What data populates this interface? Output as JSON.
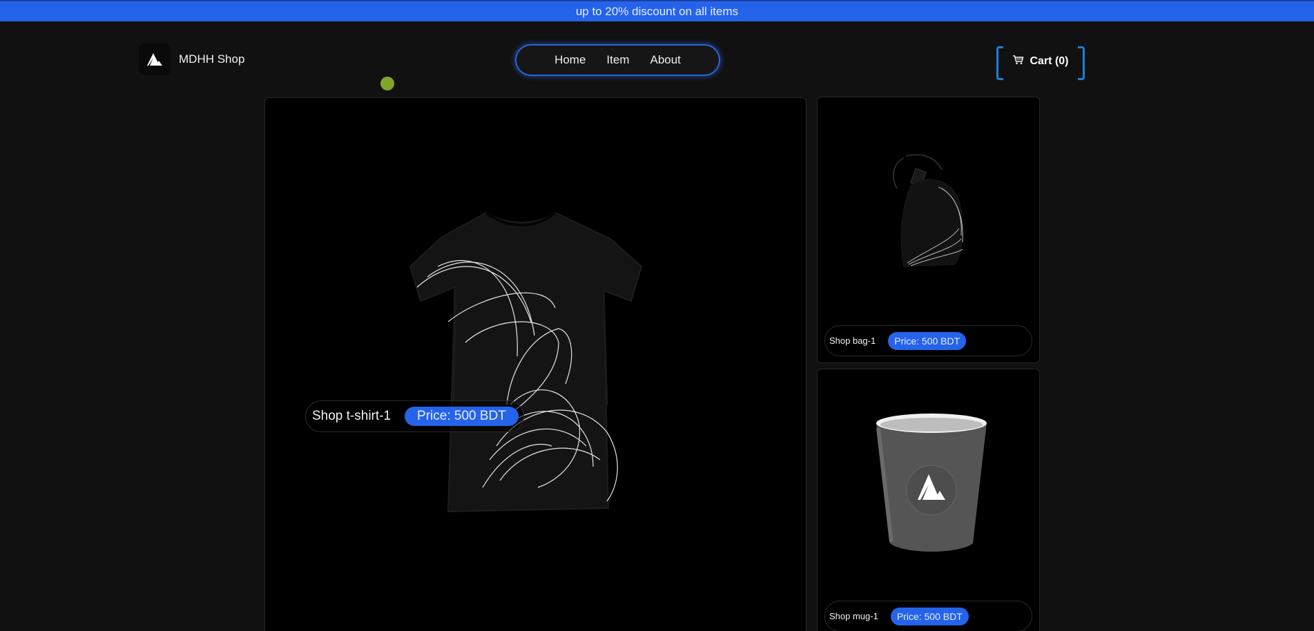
{
  "banner": {
    "text": "up to 20% discount on all items"
  },
  "header": {
    "brand": "MDHH Shop",
    "brand_icon": "triangle-logo-icon",
    "nav": [
      {
        "label": "Home"
      },
      {
        "label": "Item"
      },
      {
        "label": "About"
      }
    ],
    "cart_label": "Cart (0)",
    "cart_icon": "cart-icon"
  },
  "products": {
    "main": {
      "name": "Shop t-shirt-1",
      "price": "Price: 500 BDT"
    },
    "side_1": {
      "name": "Shop bag-1",
      "price": "Price: 500 BDT"
    },
    "side_2": {
      "name": "Shop mug-1",
      "price": "Price: 500 BDT"
    }
  },
  "colors": {
    "accent": "#2563eb",
    "background": "#111111",
    "card": "#000000",
    "cart_bracket": "#1e7ed8",
    "cursor_dot": "#7fa82a"
  }
}
